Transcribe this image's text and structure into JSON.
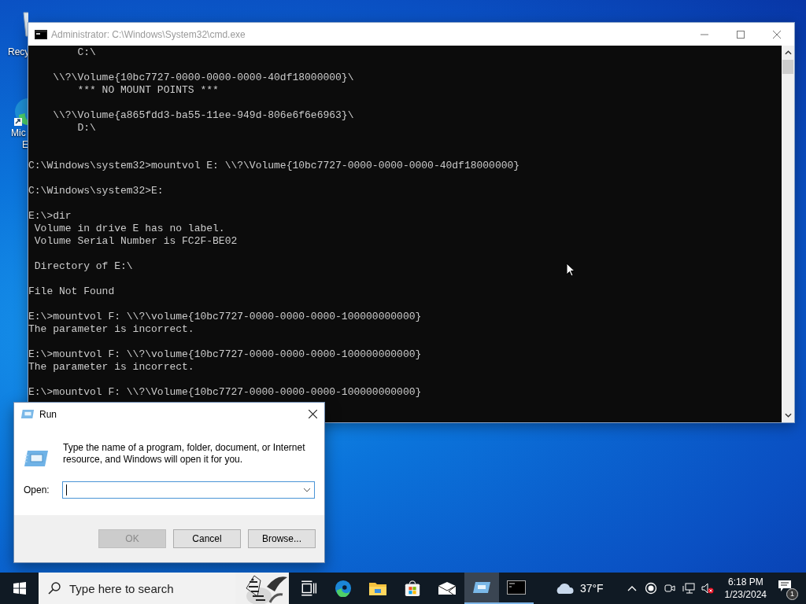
{
  "desktop_icons": [
    {
      "kind": "recycle-bin",
      "label_lines": [
        "Recy"
      ]
    },
    {
      "kind": "edge",
      "label_lines": [
        "Mic",
        "E"
      ]
    }
  ],
  "console_window": {
    "title": "Administrator: C:\\Windows\\System32\\cmd.exe",
    "active": false,
    "lines": [
      {
        "kind": "text",
        "text": "        C:\\"
      },
      {
        "kind": "blank"
      },
      {
        "kind": "text",
        "text": "    \\\\?\\Volume{10bc7727-0000-0000-0000-40df18000000}\\"
      },
      {
        "kind": "text",
        "text": "        *** NO MOUNT POINTS ***"
      },
      {
        "kind": "blank"
      },
      {
        "kind": "text",
        "text": "    \\\\?\\Volume{a865fdd3-ba55-11ee-949d-806e6f6e6963}\\"
      },
      {
        "kind": "text",
        "text": "        D:\\"
      },
      {
        "kind": "blank"
      },
      {
        "kind": "blank"
      },
      {
        "kind": "text",
        "text": "C:\\Windows\\system32>mountvol E: \\\\?\\Volume{10bc7727-0000-0000-0000-40df18000000}"
      },
      {
        "kind": "blank"
      },
      {
        "kind": "text",
        "text": "C:\\Windows\\system32>E:"
      },
      {
        "kind": "blank"
      },
      {
        "kind": "text",
        "text": "E:\\>dir"
      },
      {
        "kind": "text",
        "text": " Volume in drive E has no label."
      },
      {
        "kind": "text",
        "text": " Volume Serial Number is FC2F-BE02"
      },
      {
        "kind": "blank"
      },
      {
        "kind": "text",
        "text": " Directory of E:\\"
      },
      {
        "kind": "blank"
      },
      {
        "kind": "text",
        "text": "File Not Found"
      },
      {
        "kind": "blank"
      },
      {
        "kind": "text",
        "text": "E:\\>mountvol F: \\\\?\\volume{10bc7727-0000-0000-0000-100000000000}"
      },
      {
        "kind": "text",
        "text": "The parameter is incorrect."
      },
      {
        "kind": "blank"
      },
      {
        "kind": "text",
        "text": "E:\\>mountvol F: \\\\?\\volume{10bc7727-0000-0000-0000-100000000000}"
      },
      {
        "kind": "text",
        "text": "The parameter is incorrect."
      },
      {
        "kind": "blank"
      },
      {
        "kind": "text",
        "text": "E:\\>mountvol F: \\\\?\\Volume{10bc7727-0000-0000-0000-100000000000}"
      }
    ]
  },
  "run_dialog": {
    "title": "Run",
    "description": "Type the name of a program, folder, document, or Internet resource, and Windows will open it for you.",
    "open_label": "Open:",
    "buttons": [
      {
        "label": "OK",
        "disabled": true
      },
      {
        "label": "Cancel",
        "disabled": false
      },
      {
        "label": "Browse...",
        "disabled": false
      }
    ]
  },
  "taskbar": {
    "search": {
      "placeholder": "Type here to search"
    },
    "apps": [
      {
        "kind": "task-view",
        "open": false,
        "selected": false
      },
      {
        "kind": "edge",
        "open": false,
        "selected": false
      },
      {
        "kind": "folder",
        "open": false,
        "selected": false
      },
      {
        "kind": "store",
        "open": false,
        "selected": false
      },
      {
        "kind": "mail",
        "open": false,
        "selected": false
      },
      {
        "kind": "run",
        "open": true,
        "selected": true
      },
      {
        "kind": "console",
        "open": true,
        "selected": false
      }
    ],
    "weather": {
      "temperature": "37°F"
    },
    "tray_icons": [
      {
        "kind": "chevron"
      },
      {
        "kind": "record"
      },
      {
        "kind": "camera"
      },
      {
        "kind": "network"
      },
      {
        "kind": "volume-muted"
      }
    ],
    "clock": {
      "time": "6:18 PM",
      "date": "1/23/2024"
    },
    "notifications": {
      "count": "1"
    }
  }
}
